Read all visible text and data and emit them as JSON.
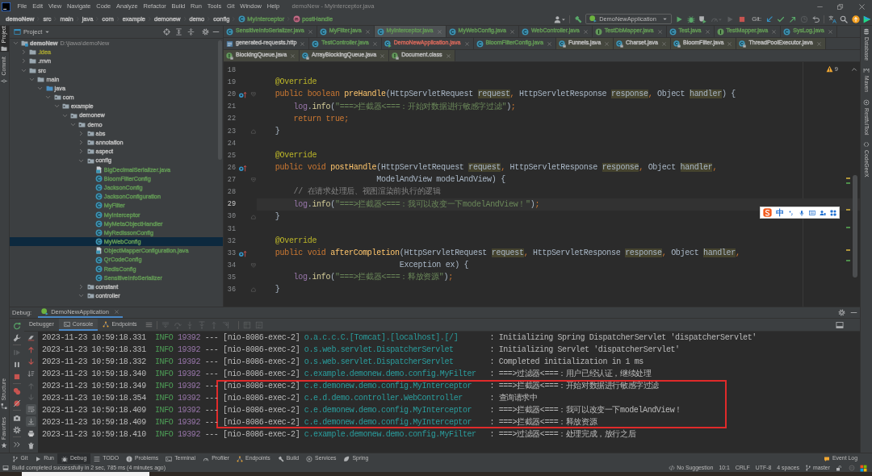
{
  "window": {
    "title": "demoNew - MyInterceptor.java"
  },
  "menu": [
    "File",
    "Edit",
    "View",
    "Navigate",
    "Code",
    "Analyze",
    "Refactor",
    "Build",
    "Run",
    "Tools",
    "Git",
    "Window",
    "Help"
  ],
  "breadcrumb": [
    {
      "label": "demoNew",
      "kind": "project"
    },
    {
      "label": "src",
      "kind": "dir"
    },
    {
      "label": "main",
      "kind": "dir"
    },
    {
      "label": "java",
      "kind": "dir"
    },
    {
      "label": "com",
      "kind": "dir"
    },
    {
      "label": "example",
      "kind": "dir"
    },
    {
      "label": "demonew",
      "kind": "dir"
    },
    {
      "label": "demo",
      "kind": "dir"
    },
    {
      "label": "config",
      "kind": "dir"
    },
    {
      "label": "MyInterceptor",
      "kind": "class",
      "color": "#629755"
    },
    {
      "label": "postHandle",
      "kind": "method",
      "color": "#629755"
    }
  ],
  "toolbar": {
    "actions": [
      {
        "kind": "account",
        "disabled": false
      },
      {
        "kind": "build",
        "disabled": false
      }
    ],
    "run_configuration": "DemoNewApplication",
    "run_actions": [
      {
        "kind": "run",
        "disabled": false
      },
      {
        "kind": "debug",
        "disabled": false
      },
      {
        "kind": "coverage",
        "disabled": false
      },
      {
        "kind": "profile",
        "disabled": true
      },
      {
        "kind": "attach",
        "disabled": true
      },
      {
        "kind": "stop",
        "disabled": false
      }
    ],
    "git_label": "Git:",
    "git_actions": [
      {
        "kind": "update",
        "disabled": false
      },
      {
        "kind": "commit",
        "disabled": false
      },
      {
        "kind": "push",
        "disabled": false
      },
      {
        "kind": "history",
        "disabled": true
      },
      {
        "kind": "rollback",
        "disabled": false
      }
    ],
    "tools": [
      {
        "kind": "translate"
      },
      {
        "kind": "search"
      },
      {
        "kind": "ide-update"
      },
      {
        "kind": "toolbox"
      }
    ]
  },
  "tool_stripes": {
    "left_top": [
      {
        "label": "Project",
        "kind": "project",
        "selected": true
      },
      {
        "label": "Commit",
        "kind": "commit",
        "selected": false
      }
    ],
    "left_bottom": [
      {
        "label": "Structure",
        "kind": "structure",
        "selected": false
      },
      {
        "label": "Favorites",
        "kind": "favorites",
        "selected": false
      }
    ],
    "right": [
      {
        "label": "Database",
        "kind": "database",
        "selected": false
      },
      {
        "label": "Maven",
        "kind": "maven",
        "selected": false
      },
      {
        "label": "RestfulTool",
        "kind": "restful",
        "selected": false
      },
      {
        "label": "CodeGeeX",
        "kind": "codegeex",
        "selected": false
      }
    ]
  },
  "project_panel": {
    "title": "Project",
    "tree": [
      {
        "label": "demoNew",
        "path": "D:\\jiawa\\demoNew",
        "kind": "module",
        "expanded": true,
        "selected": false,
        "children": [
          {
            "label": ".idea",
            "kind": "folder",
            "color": "#9c9a34",
            "expanded": false,
            "selected": false
          },
          {
            "label": ".mvn",
            "kind": "folder",
            "expanded": false,
            "selected": false
          },
          {
            "label": "src",
            "kind": "folder",
            "expanded": true,
            "selected": false,
            "children": [
              {
                "label": "main",
                "kind": "folder",
                "expanded": true,
                "selected": false,
                "children": [
                  {
                    "label": "java",
                    "kind": "source-root",
                    "expanded": true,
                    "selected": false,
                    "children": [
                      {
                        "label": "com",
                        "kind": "package",
                        "expanded": true,
                        "selected": false,
                        "children": [
                          {
                            "label": "example",
                            "kind": "package",
                            "expanded": true,
                            "selected": false,
                            "children": [
                              {
                                "label": "demonew",
                                "kind": "package",
                                "expanded": true,
                                "selected": false,
                                "children": [
                                  {
                                    "label": "demo",
                                    "kind": "package",
                                    "expanded": true,
                                    "selected": false,
                                    "children": [
                                      {
                                        "label": "abs",
                                        "kind": "package",
                                        "expanded": false,
                                        "selected": false
                                      },
                                      {
                                        "label": "annotation",
                                        "kind": "package",
                                        "expanded": false,
                                        "selected": false
                                      },
                                      {
                                        "label": "aspect",
                                        "kind": "package",
                                        "expanded": false,
                                        "selected": false
                                      },
                                      {
                                        "label": "config",
                                        "kind": "package",
                                        "expanded": true,
                                        "selected": false,
                                        "children": [
                                          {
                                            "label": "BigDecimalSerializer.java",
                                            "kind": "java-file",
                                            "color": "#629755",
                                            "selected": false
                                          },
                                          {
                                            "label": "BloomFilterConfig",
                                            "kind": "class",
                                            "color": "#629755",
                                            "selected": false
                                          },
                                          {
                                            "label": "JacksonConfig",
                                            "kind": "class",
                                            "color": "#629755",
                                            "selected": false
                                          },
                                          {
                                            "label": "JacksonConfiguration",
                                            "kind": "class",
                                            "color": "#629755",
                                            "selected": false
                                          },
                                          {
                                            "label": "MyFilter",
                                            "kind": "class",
                                            "color": "#629755",
                                            "selected": false
                                          },
                                          {
                                            "label": "MyInterceptor",
                                            "kind": "class",
                                            "color": "#629755",
                                            "selected": false
                                          },
                                          {
                                            "label": "MyMetaObjectHandler",
                                            "kind": "class",
                                            "color": "#629755",
                                            "selected": false
                                          },
                                          {
                                            "label": "MyRedissonConfig",
                                            "kind": "class",
                                            "color": "#629755",
                                            "selected": false
                                          },
                                          {
                                            "label": "MyWebConfig",
                                            "kind": "class",
                                            "color": "#629755",
                                            "selected": true
                                          },
                                          {
                                            "label": "ObjectMapperConfiguration.java",
                                            "kind": "java-file",
                                            "color": "#629755",
                                            "selected": false
                                          },
                                          {
                                            "label": "QrCodeConfig",
                                            "kind": "class",
                                            "color": "#629755",
                                            "selected": false
                                          },
                                          {
                                            "label": "RedisConfig",
                                            "kind": "class",
                                            "color": "#629755",
                                            "selected": false
                                          },
                                          {
                                            "label": "SensitiveInfoSerializer",
                                            "kind": "class",
                                            "color": "#629755",
                                            "selected": false
                                          }
                                        ]
                                      },
                                      {
                                        "label": "constant",
                                        "kind": "package",
                                        "expanded": false,
                                        "selected": false
                                      },
                                      {
                                        "label": "controller",
                                        "kind": "package",
                                        "expanded": true,
                                        "selected": false
                                      }
                                    ]
                                  }
                                ]
                              }
                            ]
                          }
                        ]
                      }
                    ]
                  }
                ]
              }
            ]
          }
        ]
      }
    ]
  },
  "editor": {
    "tab_rows": [
      {
        "tabs": [
          {
            "label": "SensitiveInfoSerializer.java",
            "kind": "class",
            "color": "#629755",
            "selected": false
          },
          {
            "label": "MyFilter.java",
            "kind": "class",
            "color": "#629755",
            "selected": false
          },
          {
            "label": "MyInterceptor.java",
            "kind": "class",
            "color": "#629755",
            "selected": true
          },
          {
            "label": "MyWebConfig.java",
            "kind": "class",
            "color": "#629755",
            "selected": false
          },
          {
            "label": "WebController.java",
            "kind": "class",
            "color": "#629755",
            "selected": false
          },
          {
            "label": "TestDbMapper.java",
            "kind": "interface",
            "color": "#629755",
            "selected": false
          },
          {
            "label": "Test.java",
            "kind": "class",
            "color": "#629755",
            "selected": false
          },
          {
            "label": "TestMapper.java",
            "kind": "interface",
            "color": "#629755",
            "selected": false
          },
          {
            "label": "SysLog.java",
            "kind": "class",
            "color": "#629755",
            "selected": false
          }
        ]
      },
      {
        "tabs": [
          {
            "label": "generated-requests.http",
            "kind": "http",
            "selected": false
          },
          {
            "label": "TestController.java",
            "kind": "class",
            "color": "#629755",
            "selected": false
          },
          {
            "label": "DemoNewApplication.java",
            "kind": "app-class",
            "color": "#d1675a",
            "selected": false
          },
          {
            "label": "BloomFilterConfig.java",
            "kind": "class",
            "color": "#629755",
            "selected": false
          },
          {
            "label": "Funnels.java",
            "kind": "lib-class",
            "selected": false
          },
          {
            "label": "Charset.java",
            "kind": "lib-class",
            "selected": false
          },
          {
            "label": "BloomFilter.java",
            "kind": "lib-class",
            "selected": false
          },
          {
            "label": "ThreadPoolExecutor.java",
            "kind": "lib-class",
            "selected": false
          }
        ]
      },
      {
        "tabs": [
          {
            "label": "BlockingQueue.java",
            "kind": "lib-interface",
            "selected": false
          },
          {
            "label": "ArrayBlockingQueue.java",
            "kind": "lib-class",
            "selected": false
          },
          {
            "label": "Document.class",
            "kind": "lib-interface",
            "selected": false
          }
        ]
      }
    ],
    "warning_count": "9",
    "lines": [
      {
        "number": "18",
        "current": false,
        "override_marker": false,
        "fold_start": false,
        "fold_end": false
      },
      {
        "number": "19",
        "current": false,
        "override_marker": false,
        "fold_start": false,
        "fold_end": false,
        "tokens": [
          {
            "text": "    @Override",
            "kind": "annotation"
          }
        ]
      },
      {
        "number": "20",
        "current": false,
        "override_marker": true,
        "fold_start": true,
        "fold_end": false,
        "tokens": [
          {
            "text": "    public boolean ",
            "kind": "keyword"
          },
          {
            "text": "preHandle",
            "kind": "method"
          },
          {
            "text": "(HttpServletRequest ",
            "kind": "plain"
          },
          {
            "text": "request",
            "kind": "param"
          },
          {
            "text": ",",
            "kind": "punct"
          },
          {
            "text": " HttpServletResponse ",
            "kind": "plain"
          },
          {
            "text": "response",
            "kind": "param"
          },
          {
            "text": ",",
            "kind": "punct"
          },
          {
            "text": " Object ",
            "kind": "plain"
          },
          {
            "text": "handler",
            "kind": "param"
          },
          {
            "text": ") {",
            "kind": "plain"
          }
        ]
      },
      {
        "number": "21",
        "current": false,
        "override_marker": false,
        "fold_start": false,
        "fold_end": false,
        "tokens": [
          {
            "text": "        log",
            "kind": "field"
          },
          {
            "text": ".",
            "kind": "plain"
          },
          {
            "text": "info",
            "kind": "call"
          },
          {
            "text": "(",
            "kind": "plain"
          },
          {
            "text": "\"===>拦截器<===：开始对数据进行敏感字过滤\"",
            "kind": "string"
          },
          {
            "text": ")",
            "kind": "plain"
          },
          {
            "text": ";",
            "kind": "punct"
          }
        ]
      },
      {
        "number": "22",
        "current": false,
        "override_marker": false,
        "fold_start": false,
        "fold_end": false,
        "tokens": [
          {
            "text": "        return true;",
            "kind": "keyword"
          }
        ]
      },
      {
        "number": "23",
        "current": false,
        "override_marker": false,
        "fold_start": false,
        "fold_end": true,
        "tokens": [
          {
            "text": "    }",
            "kind": "plain"
          }
        ]
      },
      {
        "number": "24",
        "current": false,
        "override_marker": false,
        "fold_start": false,
        "fold_end": false
      },
      {
        "number": "25",
        "current": false,
        "override_marker": false,
        "fold_start": false,
        "fold_end": false,
        "tokens": [
          {
            "text": "    @Override",
            "kind": "annotation"
          }
        ]
      },
      {
        "number": "26",
        "current": false,
        "override_marker": true,
        "fold_start": false,
        "fold_end": false,
        "tokens": [
          {
            "text": "    public void ",
            "kind": "keyword"
          },
          {
            "text": "postHandle",
            "kind": "method"
          },
          {
            "text": "(HttpServletRequest ",
            "kind": "plain"
          },
          {
            "text": "request",
            "kind": "param"
          },
          {
            "text": ",",
            "kind": "punct"
          },
          {
            "text": " HttpServletResponse ",
            "kind": "plain"
          },
          {
            "text": "response",
            "kind": "param"
          },
          {
            "text": ",",
            "kind": "punct"
          },
          {
            "text": " Object ",
            "kind": "plain"
          },
          {
            "text": "handler",
            "kind": "param"
          },
          {
            "text": ",",
            "kind": "punct"
          }
        ]
      },
      {
        "number": "27",
        "current": false,
        "override_marker": false,
        "fold_start": true,
        "fold_end": false,
        "tokens": [
          {
            "text": "                          ModelAndView modelAndView) {",
            "kind": "plain"
          }
        ]
      },
      {
        "number": "28",
        "current": false,
        "override_marker": false,
        "fold_start": false,
        "fold_end": false,
        "tokens": [
          {
            "text": "        // 在请求处理后、视图渲染前执行的逻辑",
            "kind": "comment"
          }
        ]
      },
      {
        "number": "29",
        "current": true,
        "override_marker": false,
        "fold_start": false,
        "fold_end": false,
        "tokens": [
          {
            "text": "        log",
            "kind": "field"
          },
          {
            "text": ".",
            "kind": "plain"
          },
          {
            "text": "info",
            "kind": "call"
          },
          {
            "text": "(",
            "kind": "plain"
          },
          {
            "text": "\"===>拦截器<===：我可以改变一下modelAndView！\"",
            "kind": "string"
          },
          {
            "text": ")",
            "kind": "plain"
          },
          {
            "text": ";",
            "kind": "punct"
          }
        ]
      },
      {
        "number": "30",
        "current": false,
        "override_marker": false,
        "fold_start": false,
        "fold_end": true,
        "tokens": [
          {
            "text": "    }",
            "kind": "plain"
          }
        ]
      },
      {
        "number": "31",
        "current": false,
        "override_marker": false,
        "fold_start": false,
        "fold_end": false
      },
      {
        "number": "32",
        "current": false,
        "override_marker": false,
        "fold_start": false,
        "fold_end": false,
        "tokens": [
          {
            "text": "    @Override",
            "kind": "annotation"
          }
        ]
      },
      {
        "number": "33",
        "current": false,
        "override_marker": true,
        "fold_start": false,
        "fold_end": false,
        "tokens": [
          {
            "text": "    public void ",
            "kind": "keyword"
          },
          {
            "text": "afterCompletion",
            "kind": "method"
          },
          {
            "text": "(HttpServletRequest ",
            "kind": "plain"
          },
          {
            "text": "request",
            "kind": "param"
          },
          {
            "text": ",",
            "kind": "punct"
          },
          {
            "text": " HttpServletResponse ",
            "kind": "plain"
          },
          {
            "text": "response",
            "kind": "param"
          },
          {
            "text": ",",
            "kind": "punct"
          },
          {
            "text": " Object ",
            "kind": "plain"
          },
          {
            "text": "handler",
            "kind": "param"
          },
          {
            "text": ",",
            "kind": "punct"
          }
        ]
      },
      {
        "number": "34",
        "current": false,
        "override_marker": false,
        "fold_start": true,
        "fold_end": false,
        "tokens": [
          {
            "text": "                               Exception ex) {",
            "kind": "plain"
          }
        ]
      },
      {
        "number": "35",
        "current": false,
        "override_marker": false,
        "fold_start": false,
        "fold_end": false,
        "tokens": [
          {
            "text": "        log",
            "kind": "field"
          },
          {
            "text": ".",
            "kind": "plain"
          },
          {
            "text": "info",
            "kind": "call"
          },
          {
            "text": "(",
            "kind": "plain"
          },
          {
            "text": "\"===>拦截器<===：释放资源\"",
            "kind": "string"
          },
          {
            "text": ")",
            "kind": "plain"
          },
          {
            "text": ";",
            "kind": "punct"
          }
        ]
      },
      {
        "number": "36",
        "current": false,
        "override_marker": false,
        "fold_start": false,
        "fold_end": true,
        "tokens": [
          {
            "text": "    }",
            "kind": "plain"
          }
        ]
      }
    ]
  },
  "ime_toolbar": {
    "mode": "中"
  },
  "debug": {
    "title": "Debug:",
    "sessions": [
      {
        "label": "DemoNewApplication",
        "selected": true
      }
    ],
    "side_action_groups": [
      {
        "actions": [
          {
            "kind": "rerun",
            "disabled": false
          },
          {
            "kind": "modify",
            "disabled": false
          }
        ]
      },
      {
        "actions": [
          {
            "kind": "resume",
            "disabled": true
          },
          {
            "kind": "pause",
            "disabled": false
          },
          {
            "kind": "stop",
            "disabled": false
          }
        ]
      },
      {
        "actions": [
          {
            "kind": "breakpoints",
            "disabled": false
          },
          {
            "kind": "mute",
            "disabled": false
          }
        ]
      },
      {
        "actions": [
          {
            "kind": "snapshot",
            "disabled": false
          },
          {
            "kind": "settings",
            "disabled": false
          }
        ]
      },
      {
        "actions": [
          {
            "kind": "more",
            "disabled": false
          }
        ]
      }
    ],
    "tabs": [
      {
        "label": "Debugger",
        "kind": "debugger",
        "selected": false
      },
      {
        "label": "Console",
        "kind": "console",
        "selected": true
      },
      {
        "label": "Endpoints",
        "kind": "endpoints",
        "selected": false
      }
    ],
    "stepping_action_groups": [
      {
        "actions": [
          {
            "kind": "show-execution-point",
            "disabled": true
          },
          {
            "kind": "step-over",
            "disabled": true
          },
          {
            "kind": "step-into",
            "disabled": true
          },
          {
            "kind": "force-step-into",
            "disabled": true
          },
          {
            "kind": "step-out",
            "disabled": true
          },
          {
            "kind": "run-to-cursor",
            "disabled": true
          }
        ]
      },
      {
        "actions": [
          {
            "kind": "evaluate",
            "disabled": true
          },
          {
            "kind": "trace",
            "disabled": true
          }
        ]
      }
    ],
    "console_actions": [
      {
        "kind": "clear",
        "disabled": false,
        "on": false
      },
      {
        "kind": "stack-up",
        "disabled": false,
        "on": false
      },
      {
        "kind": "stack-down",
        "disabled": false,
        "on": false
      },
      {
        "kind": "sort",
        "disabled": false,
        "on": false
      },
      {
        "kind": "previous",
        "disabled": true,
        "on": false
      },
      {
        "kind": "next",
        "disabled": true,
        "on": false
      },
      {
        "kind": "soft-wrap",
        "disabled": false,
        "on": true
      },
      {
        "kind": "scroll-end",
        "disabled": false,
        "on": true
      },
      {
        "kind": "print",
        "disabled": false,
        "on": false
      },
      {
        "kind": "delete",
        "disabled": false,
        "on": false
      }
    ],
    "console": [
      {
        "timestamp": "2023-11-23 10:59:18.331",
        "severity": "INFO",
        "pid": "19392",
        "separator": "---",
        "thread": "[nio-8086-exec-2]",
        "logger": "o.a.c.c.C.[Tomcat].[localhost].[/]",
        "message": ": Initializing Spring DispatcherServlet 'dispatcherServlet'",
        "boxed": false
      },
      {
        "timestamp": "2023-11-23 10:59:18.331",
        "severity": "INFO",
        "pid": "19392",
        "separator": "---",
        "thread": "[nio-8086-exec-2]",
        "logger": "o.s.web.servlet.DispatcherServlet",
        "message": ": Initializing Servlet 'dispatcherServlet'",
        "boxed": false
      },
      {
        "timestamp": "2023-11-23 10:59:18.332",
        "severity": "INFO",
        "pid": "19392",
        "separator": "---",
        "thread": "[nio-8086-exec-2]",
        "logger": "o.s.web.servlet.DispatcherServlet",
        "message": ": Completed initialization in 1 ms",
        "boxed": false
      },
      {
        "timestamp": "2023-11-23 10:59:18.340",
        "severity": "INFO",
        "pid": "19392",
        "separator": "---",
        "thread": "[nio-8086-exec-2]",
        "logger": "c.example.demonew.demo.config.MyFilter",
        "message": ": ===>过滤器<===：用户已经认证，继续处理",
        "boxed": false
      },
      {
        "timestamp": "2023-11-23 10:59:18.349",
        "severity": "INFO",
        "pid": "19392",
        "separator": "---",
        "thread": "[nio-8086-exec-2]",
        "logger": "c.e.demonew.demo.config.MyInterceptor",
        "message": ": ===>拦截器<===：开始对数据进行敏感字过滤",
        "boxed": true
      },
      {
        "timestamp": "2023-11-23 10:59:18.354",
        "severity": "INFO",
        "pid": "19392",
        "separator": "---",
        "thread": "[nio-8086-exec-2]",
        "logger": "c.e.d.demo.controller.WebController",
        "message": ": 查询请求中",
        "boxed": true
      },
      {
        "timestamp": "2023-11-23 10:59:18.409",
        "severity": "INFO",
        "pid": "19392",
        "separator": "---",
        "thread": "[nio-8086-exec-2]",
        "logger": "c.e.demonew.demo.config.MyInterceptor",
        "message": ": ===>拦截器<===：我可以改变一下modelAndView！",
        "boxed": true
      },
      {
        "timestamp": "2023-11-23 10:59:18.409",
        "severity": "INFO",
        "pid": "19392",
        "separator": "---",
        "thread": "[nio-8086-exec-2]",
        "logger": "c.e.demonew.demo.config.MyInterceptor",
        "message": ": ===>拦截器<===：释放资源",
        "boxed": true
      },
      {
        "timestamp": "2023-11-23 10:59:18.410",
        "severity": "INFO",
        "pid": "19392",
        "separator": "---",
        "thread": "[nio-8086-exec-2]",
        "logger": "c.example.demonew.demo.config.MyFilter",
        "message": ": ===>过滤器<===：处理完成，放行之后",
        "boxed": false
      }
    ]
  },
  "bottom_tool_tabs": [
    {
      "label": "Git",
      "kind": "git",
      "selected": false
    },
    {
      "label": "Run",
      "kind": "run",
      "selected": false
    },
    {
      "label": "Debug",
      "kind": "debug",
      "selected": true
    },
    {
      "label": "TODO",
      "kind": "todo",
      "selected": false
    },
    {
      "label": "Problems",
      "kind": "problems",
      "selected": false
    },
    {
      "label": "Terminal",
      "kind": "terminal",
      "selected": false
    },
    {
      "label": "Profiler",
      "kind": "profiler",
      "selected": false
    },
    {
      "label": "Endpoints",
      "kind": "endpoints",
      "selected": false
    },
    {
      "label": "Build",
      "kind": "build",
      "selected": false
    },
    {
      "label": "Services",
      "kind": "services",
      "selected": false
    },
    {
      "label": "Spring",
      "kind": "spring",
      "selected": false
    }
  ],
  "event_log": "Event Log",
  "status_bar": {
    "message": "Build completed successfully in 2 sec, 785 ms (4 minutes ago)",
    "items": [
      {
        "label": "No Suggestion",
        "kind": "suggestion"
      },
      {
        "label": "10:1",
        "kind": "caret"
      },
      {
        "label": "CRLF",
        "kind": "line-separator"
      },
      {
        "label": "UTF-8",
        "kind": "encoding"
      },
      {
        "label": "4 spaces",
        "kind": "indent"
      },
      {
        "label": "master",
        "kind": "branch"
      }
    ]
  }
}
